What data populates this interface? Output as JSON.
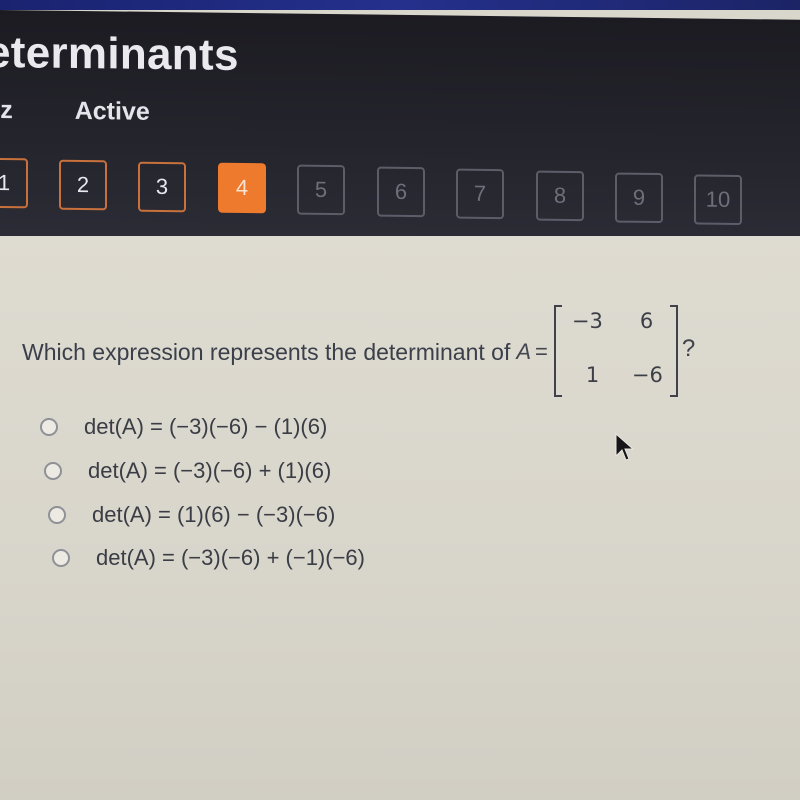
{
  "header": {
    "title": "eterminants",
    "subnav": [
      {
        "label": "uiz"
      },
      {
        "label": "Active"
      }
    ]
  },
  "question_nav": {
    "current": 4,
    "buttons": [
      {
        "label": "1",
        "state": "done"
      },
      {
        "label": "2",
        "state": "done"
      },
      {
        "label": "3",
        "state": "done"
      },
      {
        "label": "4",
        "state": "active"
      },
      {
        "label": "5",
        "state": "todo"
      },
      {
        "label": "6",
        "state": "todo"
      },
      {
        "label": "7",
        "state": "todo"
      },
      {
        "label": "8",
        "state": "todo"
      },
      {
        "label": "9",
        "state": "todo"
      },
      {
        "label": "10",
        "state": "todo"
      }
    ]
  },
  "question": {
    "prompt": "Which expression represents the determinant of",
    "matrix_label": "A",
    "equals": "=",
    "matrix": [
      [
        "−3",
        "6"
      ],
      [
        "1",
        "−6"
      ]
    ],
    "end": "?"
  },
  "options": [
    {
      "text": "det(A) = (−3)(−6) − (1)(6)",
      "selected": false
    },
    {
      "text": "det(A) = (−3)(−6) + (1)(6)",
      "selected": false
    },
    {
      "text": "det(A) = (1)(6) − (−3)(−6)",
      "selected": false
    },
    {
      "text": "det(A) = (−3)(−6) + (−1)(−6)",
      "selected": false
    }
  ],
  "colors": {
    "accent": "#ee7a2d",
    "header_bg": "#22222a",
    "content_bg": "#dad7cd"
  }
}
